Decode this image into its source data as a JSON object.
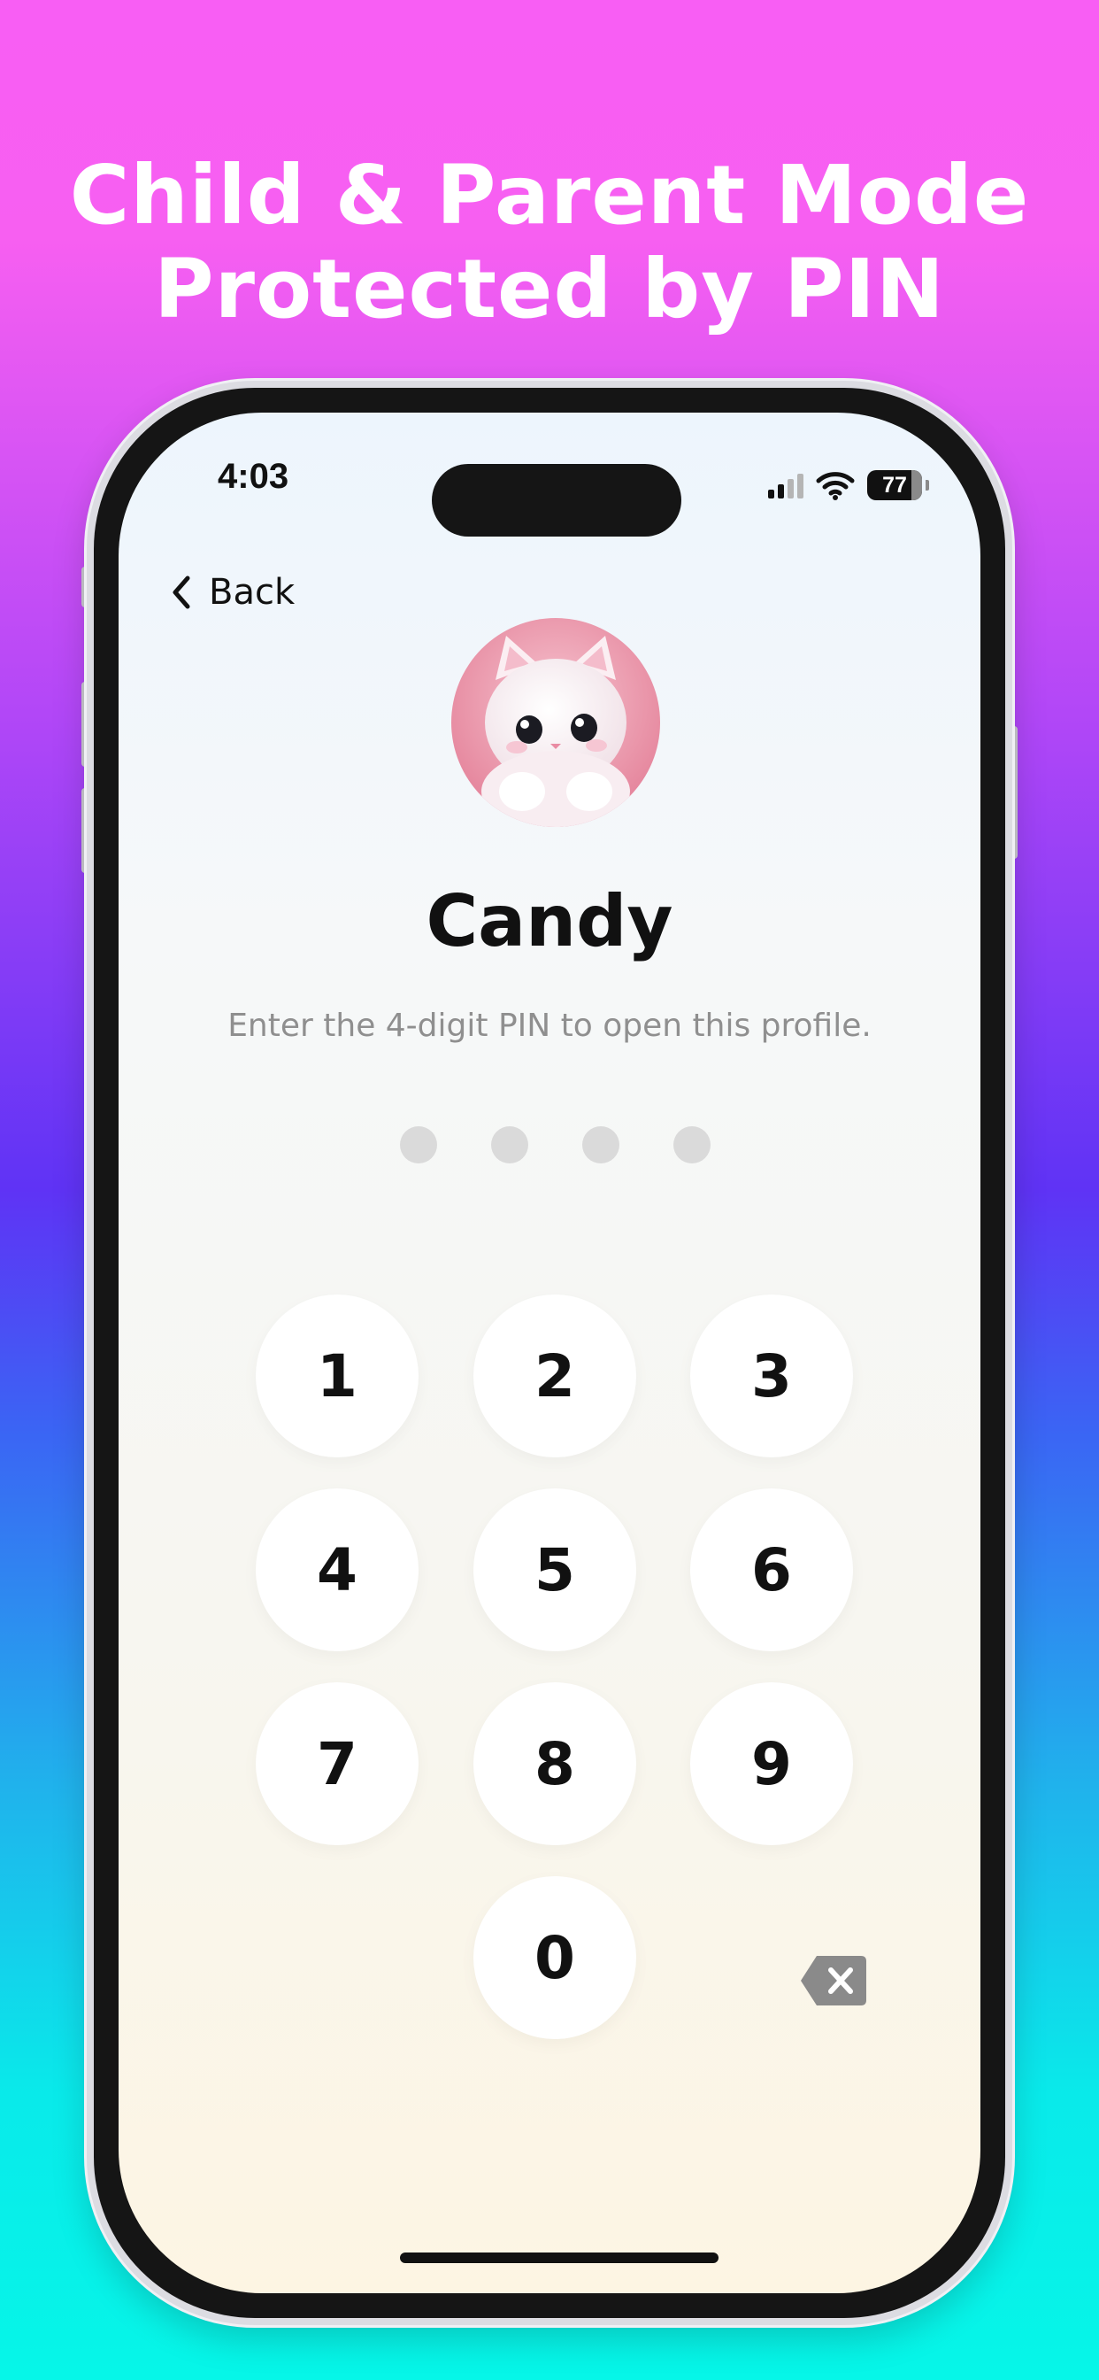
{
  "headline": {
    "line1": "Child & Parent Mode",
    "line2": "Protected by PIN"
  },
  "status_bar": {
    "time": "4:03",
    "battery": "77",
    "icons": [
      "cellular-signal-icon",
      "wifi-icon",
      "battery-icon"
    ]
  },
  "nav": {
    "back_label": "Back",
    "back_icon": "chevron-left-icon"
  },
  "profile": {
    "name": "Candy",
    "avatar": "white-kitten-avatar",
    "prompt": "Enter the 4-digit PIN to open this profile."
  },
  "pin": {
    "length": 4,
    "entered": 0
  },
  "keypad": {
    "keys": [
      "1",
      "2",
      "3",
      "4",
      "5",
      "6",
      "7",
      "8",
      "9",
      "0"
    ],
    "delete_icon": "backspace-icon"
  },
  "colors": {
    "gradient_top": "#f85ef4",
    "gradient_mid": "#5f33f5",
    "gradient_bottom": "#06f6e8",
    "dot_empty": "#dadada",
    "key_bg": "#ffffff",
    "delete_icon": "#8a8a8a"
  }
}
